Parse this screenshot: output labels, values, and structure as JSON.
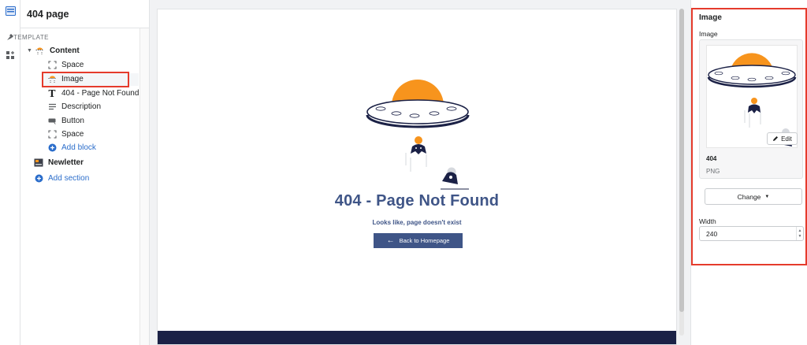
{
  "sidebar": {
    "page_title": "404 page",
    "section_label": "TEMPLATE",
    "content_label": "Content",
    "items": [
      {
        "label": "Space",
        "icon": "space-icon"
      },
      {
        "label": "Image",
        "icon": "image-icon"
      },
      {
        "label": "404 - Page Not Found",
        "icon": "text-icon"
      },
      {
        "label": "Description",
        "icon": "paragraph-icon"
      },
      {
        "label": "Button",
        "icon": "button-icon"
      },
      {
        "label": "Space",
        "icon": "space-icon"
      }
    ],
    "add_block": "Add block",
    "newsletter": "Newletter",
    "add_section": "Add section"
  },
  "preview": {
    "title": "404 - Page Not Found",
    "subtitle": "Looks like, page doesn't exist",
    "button_label": "Back to Homepage",
    "button_arrow": "←"
  },
  "inspector": {
    "title": "Image",
    "image_label": "Image",
    "edit_label": "Edit",
    "file_name": "404",
    "file_type": "PNG",
    "change_label": "Change",
    "width_label": "Width",
    "width_value": "240"
  },
  "colors": {
    "accent": "#2c6ecb",
    "brand_navy": "#3f5587",
    "highlight": "#e53b2c",
    "ufo_orange": "#f7941d"
  }
}
